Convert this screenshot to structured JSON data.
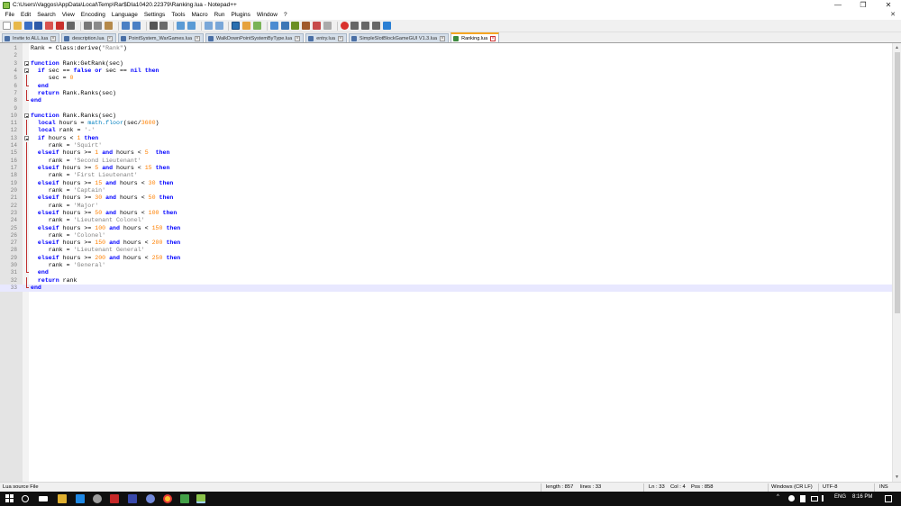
{
  "window": {
    "title": "C:\\Users\\Vaggos\\AppData\\Local\\Temp\\Rar$DIa10420.22379\\Ranking.lua - Notepad++",
    "controls": [
      "—",
      "❐",
      "✕"
    ]
  },
  "menu": [
    "File",
    "Edit",
    "Search",
    "View",
    "Encoding",
    "Language",
    "Settings",
    "Tools",
    "Macro",
    "Run",
    "Plugins",
    "Window",
    "?"
  ],
  "menu_close": "✕",
  "tabs": [
    {
      "label": "Invite to ALL.lua"
    },
    {
      "label": "description.lua"
    },
    {
      "label": "PointSystem_WarGames.lua"
    },
    {
      "label": "WalkDownPointSystemByType.lua"
    },
    {
      "label": "entry.lua"
    },
    {
      "label": "SimpleSlotBlockGameGUI V1.3.lua"
    },
    {
      "label": "Ranking.lua",
      "active": true
    }
  ],
  "editor": {
    "lines": [
      {
        "n": "1",
        "fold": "",
        "html": "Rank = Class:derive(<span class='s'>\"Rank\"</span>)"
      },
      {
        "n": "2",
        "fold": "",
        "html": ""
      },
      {
        "n": "3",
        "fold": "box",
        "html": "<span class='k'>function</span> Rank:GetRank(sec)"
      },
      {
        "n": "4",
        "fold": "box",
        "html": "  <span class='k'>if</span> sec == <span class='k'>false</span> <span class='k'>or</span> sec == <span class='k'>nil</span> <span class='k'>then</span>"
      },
      {
        "n": "5",
        "fold": "bar",
        "html": "     sec = <span class='n'>0</span>"
      },
      {
        "n": "6",
        "fold": "endmark",
        "html": "  <span class='k'>end</span>"
      },
      {
        "n": "7",
        "fold": "bar",
        "html": "  <span class='k'>return</span> Rank.Ranks(sec)"
      },
      {
        "n": "8",
        "fold": "endmark",
        "html": "<span class='k'>end</span>"
      },
      {
        "n": "9",
        "fold": "",
        "html": ""
      },
      {
        "n": "10",
        "fold": "box",
        "html": "<span class='k'>function</span> Rank.Ranks(sec)"
      },
      {
        "n": "11",
        "fold": "bar",
        "html": "  <span class='k'>local</span> hours = <span class='f'>math.floor</span>(sec/<span class='n'>3600</span>)"
      },
      {
        "n": "12",
        "fold": "bar",
        "html": "  <span class='k'>local</span> rank = <span class='s'>'-'</span>"
      },
      {
        "n": "13",
        "fold": "box",
        "html": "  <span class='k'>if</span> hours &lt; <span class='n'>1</span> <span class='k'>then</span>"
      },
      {
        "n": "14",
        "fold": "bar",
        "html": "     rank = <span class='s'>'Squirt'</span>"
      },
      {
        "n": "15",
        "fold": "bar",
        "html": "  <span class='k'>elseif</span> hours &gt;= <span class='n'>1</span> <span class='k'>and</span> hours &lt; <span class='n'>5</span>  <span class='k'>then</span>"
      },
      {
        "n": "16",
        "fold": "bar",
        "html": "     rank = <span class='s'>'Second Lieutenant'</span>"
      },
      {
        "n": "17",
        "fold": "bar",
        "html": "  <span class='k'>elseif</span> hours &gt;= <span class='n'>5</span> <span class='k'>and</span> hours &lt; <span class='n'>15</span> <span class='k'>then</span>"
      },
      {
        "n": "18",
        "fold": "bar",
        "html": "     rank = <span class='s'>'First Lieutenant'</span>"
      },
      {
        "n": "19",
        "fold": "bar",
        "html": "  <span class='k'>elseif</span> hours &gt;= <span class='n'>15</span> <span class='k'>and</span> hours &lt; <span class='n'>30</span> <span class='k'>then</span>"
      },
      {
        "n": "20",
        "fold": "bar",
        "html": "     rank = <span class='s'>'Captain'</span>"
      },
      {
        "n": "21",
        "fold": "bar",
        "html": "  <span class='k'>elseif</span> hours &gt;= <span class='n'>30</span> <span class='k'>and</span> hours &lt; <span class='n'>50</span> <span class='k'>then</span>"
      },
      {
        "n": "22",
        "fold": "bar",
        "html": "     rank = <span class='s'>'Major'</span>"
      },
      {
        "n": "23",
        "fold": "bar",
        "html": "  <span class='k'>elseif</span> hours &gt;= <span class='n'>50</span> <span class='k'>and</span> hours &lt; <span class='n'>100</span> <span class='k'>then</span>"
      },
      {
        "n": "24",
        "fold": "bar",
        "html": "     rank = <span class='s'>'Lieutenant Colonel'</span>"
      },
      {
        "n": "25",
        "fold": "bar",
        "html": "  <span class='k'>elseif</span> hours &gt;= <span class='n'>100</span> <span class='k'>and</span> hours &lt; <span class='n'>150</span> <span class='k'>then</span>"
      },
      {
        "n": "26",
        "fold": "bar",
        "html": "     rank = <span class='s'>'Colonel'</span>"
      },
      {
        "n": "27",
        "fold": "bar",
        "html": "  <span class='k'>elseif</span> hours &gt;= <span class='n'>150</span> <span class='k'>and</span> hours &lt; <span class='n'>200</span> <span class='k'>then</span>"
      },
      {
        "n": "28",
        "fold": "bar",
        "html": "     rank = <span class='s'>'Lieutenant General'</span>"
      },
      {
        "n": "29",
        "fold": "bar",
        "html": "  <span class='k'>elseif</span> hours &gt;= <span class='n'>200</span> <span class='k'>and</span> hours &lt; <span class='n'>250</span> <span class='k'>then</span>"
      },
      {
        "n": "30",
        "fold": "bar",
        "html": "     rank = <span class='s'>'General'</span>"
      },
      {
        "n": "31",
        "fold": "endmark",
        "html": "  <span class='k'>end</span>"
      },
      {
        "n": "32",
        "fold": "bar",
        "html": "  <span class='k'>return</span> rank"
      },
      {
        "n": "33",
        "fold": "endmark",
        "html": "<span class='k'>end</span>",
        "current": true
      }
    ]
  },
  "status": {
    "filetype": "Lua source File",
    "length": "length : 857",
    "lines": "lines : 33",
    "ln": "Ln : 33",
    "col": "Col : 4",
    "pos": "Pos : 858",
    "eol": "Windows (CR LF)",
    "encoding": "UTF-8",
    "mode": "INS"
  },
  "taskbar": {
    "lang": "ENG",
    "time": "8:16 PM",
    "tray_arrow": "^"
  },
  "colors": {
    "keyword": "#0000ff",
    "number": "#ff8000",
    "string": "#808080",
    "current_line": "#e8e8ff",
    "active_tab_accent": "#f5a623",
    "taskbar": "#101010"
  }
}
